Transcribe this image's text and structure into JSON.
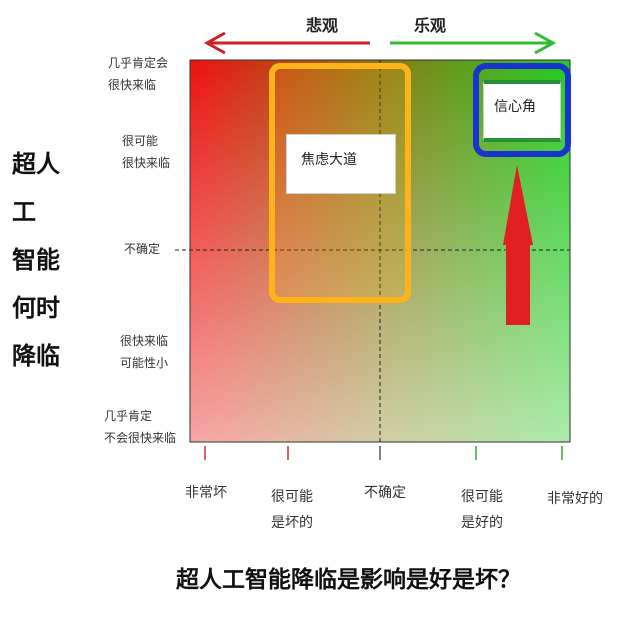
{
  "header": {
    "pessimistic_label": "悲观",
    "optimistic_label": "乐观"
  },
  "y_axis": {
    "title_lines": [
      "超人工",
      "智能",
      "何时",
      "降临"
    ],
    "ticks": [
      {
        "line1": "几乎肯定会",
        "line2": "很快来临"
      },
      {
        "line1": "很可能",
        "line2": "很快来临"
      },
      {
        "line1": "不确定",
        "line2": ""
      },
      {
        "line1": "很快来临",
        "line2": "可能性小"
      },
      {
        "line1": "几乎肯定",
        "line2": "不会很快来临"
      }
    ]
  },
  "x_axis": {
    "ticks": [
      {
        "line1": "非常坏",
        "line2": ""
      },
      {
        "line1": "很可能",
        "line2": "是坏的"
      },
      {
        "line1": "不确定",
        "line2": ""
      },
      {
        "line1": "很可能",
        "line2": "是好的"
      },
      {
        "line1": "非常好的",
        "line2": ""
      }
    ]
  },
  "regions": {
    "anxiety_avenue": "焦虑大道",
    "confidence_corner": "信心角"
  },
  "footer": {
    "question": "超人工智能降临是影响是好是坏？"
  },
  "colors": {
    "red": "#ee1111",
    "green": "#22cc22",
    "orange": "#ffb31a",
    "blue": "#1a33cc",
    "arrow_red": "#e02020"
  }
}
